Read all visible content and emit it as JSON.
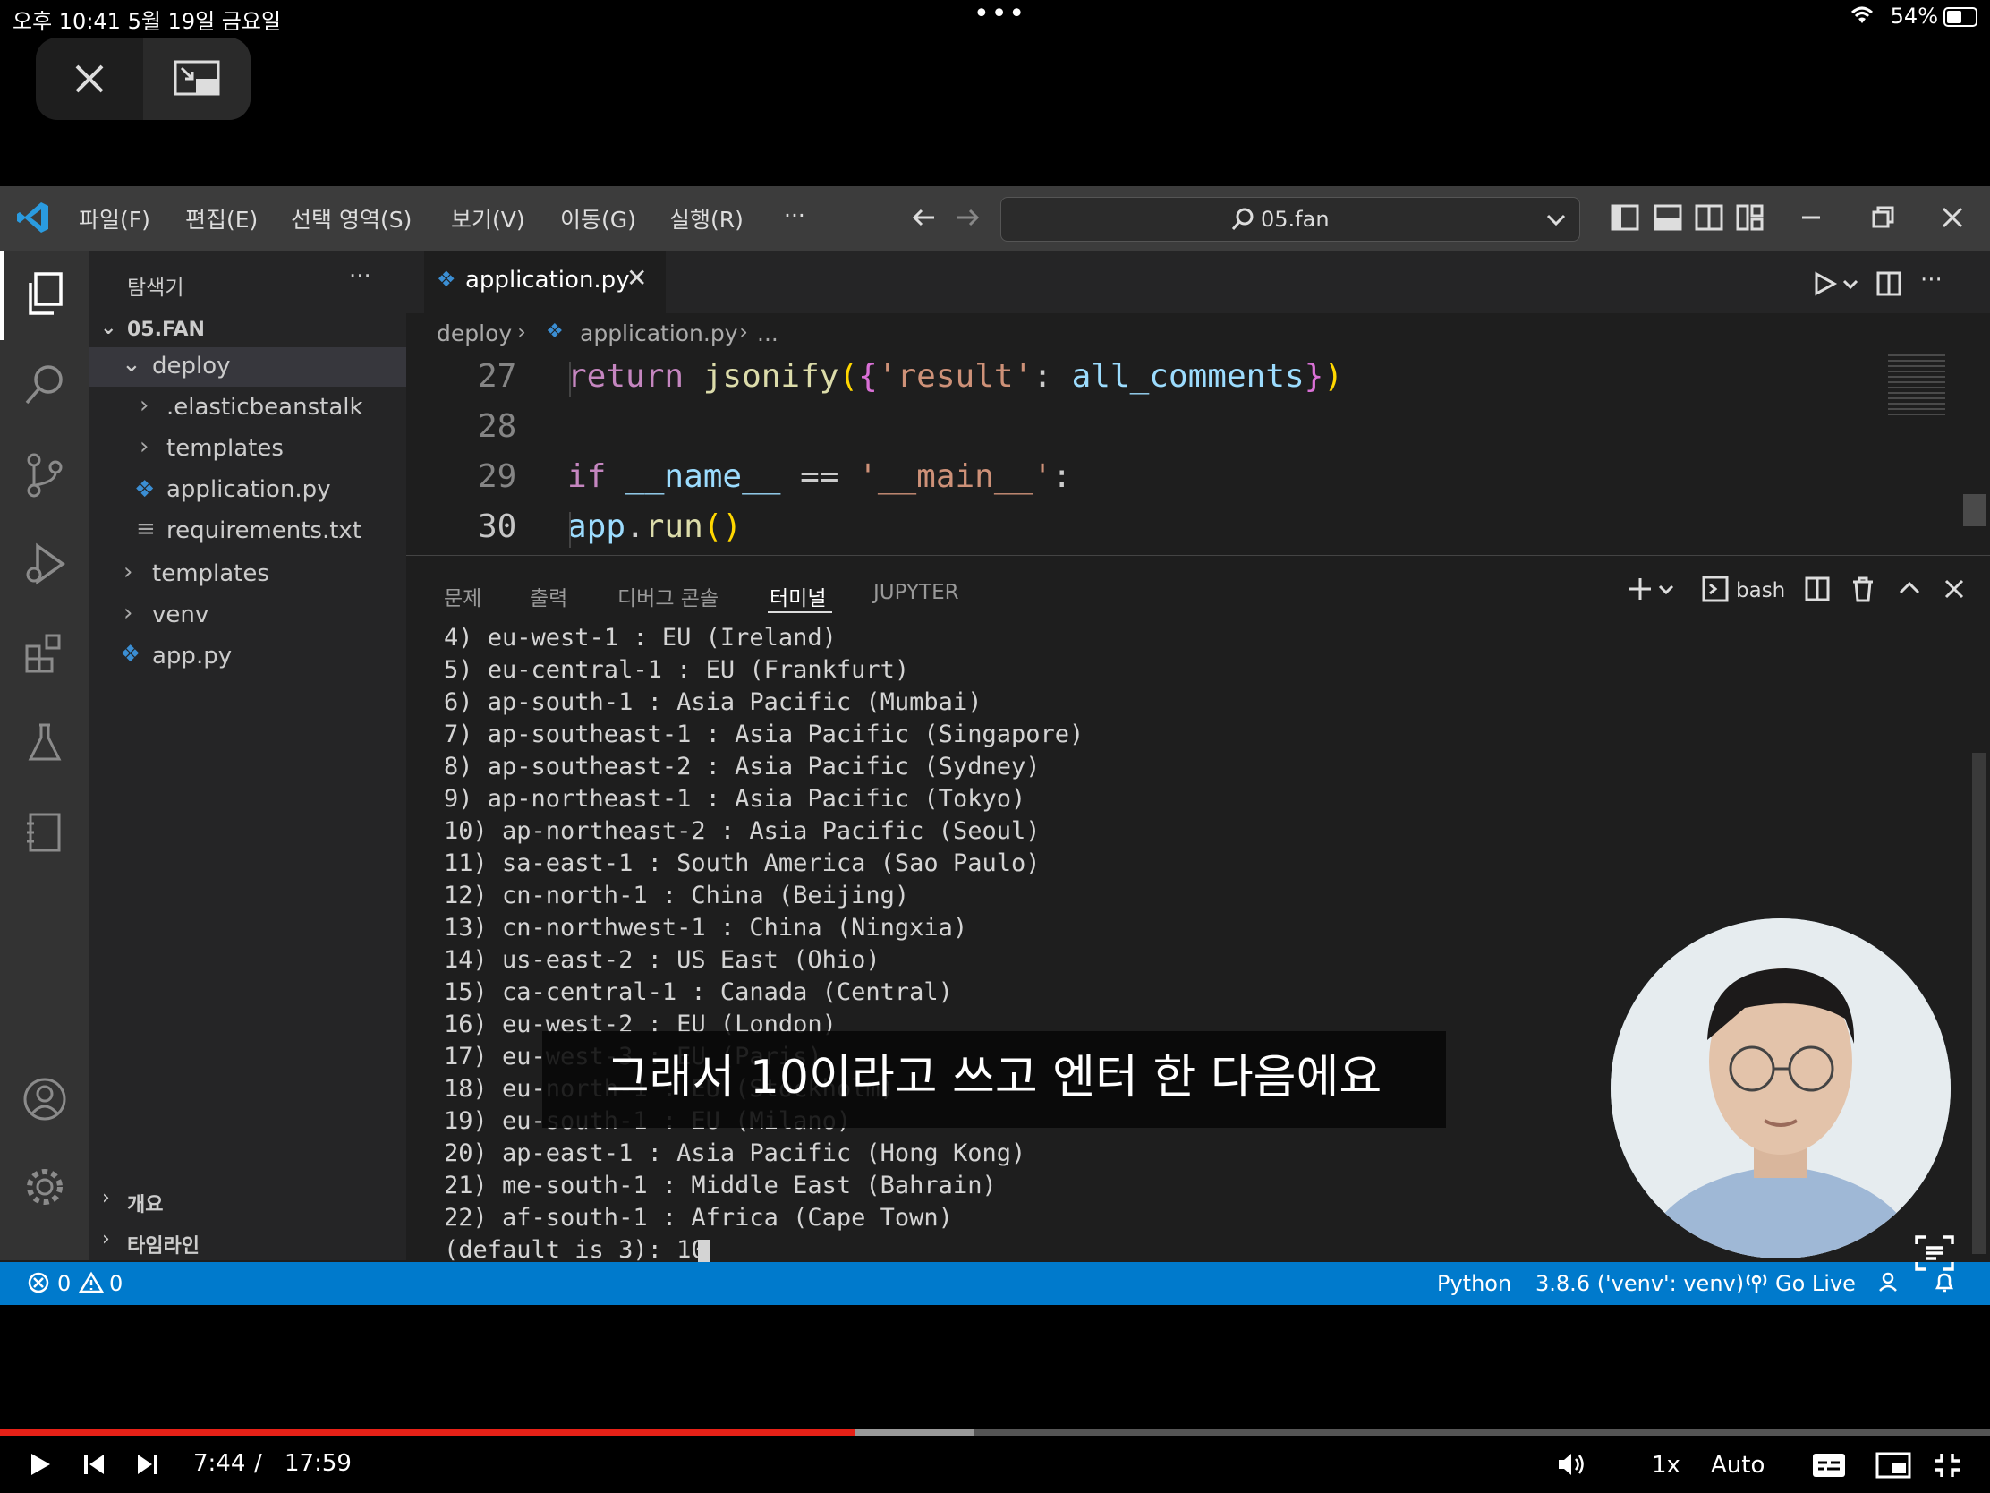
{
  "status_bar": {
    "time_date": "오후 10:41   5월 19일 금요일",
    "dots": "•••",
    "battery": "54%"
  },
  "pip": {
    "close_icon": "close-icon",
    "pip_icon": "picture-in-picture-icon"
  },
  "titlebar": {
    "menu": [
      "파일(F)",
      "편집(E)",
      "선택 영역(S)",
      "보기(V)",
      "이동(G)",
      "실행(R)",
      "···"
    ],
    "search": "05.fan"
  },
  "sidebar": {
    "title": "탐색기",
    "root": "05.FAN",
    "items": [
      {
        "label": "deploy"
      },
      {
        "label": ".elasticbeanstalk"
      },
      {
        "label": "templates"
      },
      {
        "label": "application.py"
      },
      {
        "label": "requirements.txt"
      },
      {
        "label": "templates"
      },
      {
        "label": "venv"
      },
      {
        "label": "app.py"
      }
    ],
    "outline": "개요",
    "timeline": "타임라인"
  },
  "editor": {
    "tab": "application.py",
    "breadcrumb": {
      "folder": "deploy",
      "file": "application.py",
      "rest": "..."
    },
    "lines": [
      {
        "num": "27",
        "code": "    return jsonify({'result': all_comments})"
      },
      {
        "num": "28",
        "code": ""
      },
      {
        "num": "29",
        "code": "if __name__ == '__main__':"
      },
      {
        "num": "30",
        "code": "    app.run()"
      }
    ]
  },
  "panel": {
    "tabs": [
      "문제",
      "출력",
      "디버그 콘솔",
      "터미널",
      "JUPYTER"
    ],
    "shell": "bash",
    "terminal_lines": [
      "4) eu-west-1 : EU (Ireland)",
      "5) eu-central-1 : EU (Frankfurt)",
      "6) ap-south-1 : Asia Pacific (Mumbai)",
      "7) ap-southeast-1 : Asia Pacific (Singapore)",
      "8) ap-southeast-2 : Asia Pacific (Sydney)",
      "9) ap-northeast-1 : Asia Pacific (Tokyo)",
      "10) ap-northeast-2 : Asia Pacific (Seoul)",
      "11) sa-east-1 : South America (Sao Paulo)",
      "12) cn-north-1 : China (Beijing)",
      "13) cn-northwest-1 : China (Ningxia)",
      "14) us-east-2 : US East (Ohio)",
      "15) ca-central-1 : Canada (Central)",
      "16) eu-west-2 : EU (London)",
      "17) eu-west-3 : EU (Paris)",
      "18) eu-north-1 : EU (Stockholm)",
      "19) eu-south-1 : EU (Milano)",
      "20) ap-east-1 : Asia Pacific (Hong Kong)",
      "21) me-south-1 : Middle East (Bahrain)",
      "22) af-south-1 : Africa (Cape Town)",
      "(default is 3): 10"
    ]
  },
  "statusbar": {
    "errors": "0",
    "warnings": "0",
    "language": "Python",
    "interpreter": "3.8.6 ('venv': venv)",
    "golive": "Go Live"
  },
  "caption": "그래서 10이라고 쓰고 엔터 한 다음에요",
  "video": {
    "current": "7:44",
    "separator": "/",
    "duration": "17:59",
    "progress": 0.43,
    "buffered": 0.489,
    "speed": "1x",
    "quality": "Auto"
  },
  "colors": {
    "accent": "#007acc",
    "progress": "#e62117",
    "keyword": "#c586c0",
    "function": "#dcdcaa",
    "string": "#ce9178",
    "variable": "#9cdcfe"
  }
}
